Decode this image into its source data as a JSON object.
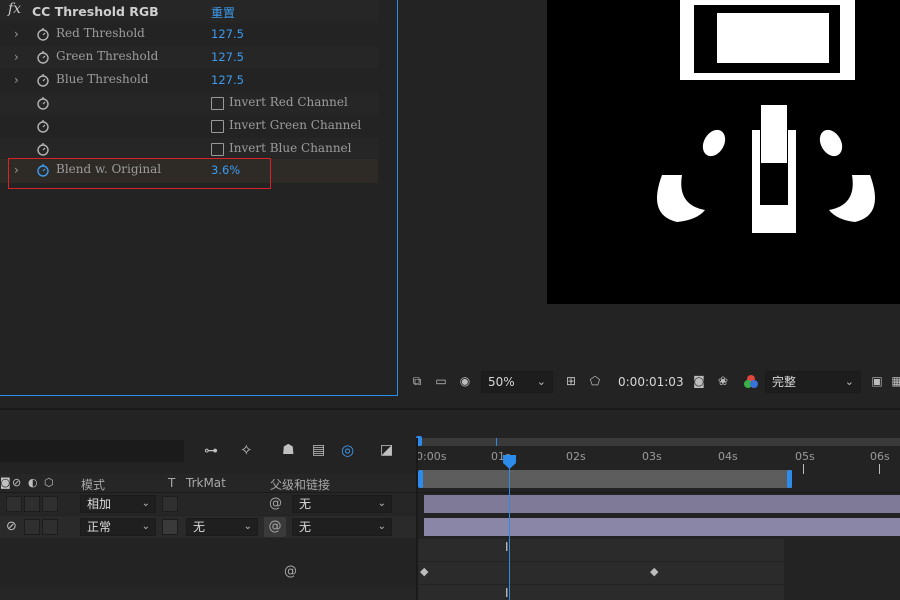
{
  "effect": {
    "fx_label": "fx",
    "name": "CC Threshold RGB",
    "reset": "重置",
    "params": [
      {
        "label": "Red Threshold",
        "value": "127.5"
      },
      {
        "label": "Green Threshold",
        "value": "127.5"
      },
      {
        "label": "Blue Threshold",
        "value": "127.5"
      }
    ],
    "checkboxes": [
      {
        "label": "Invert Red Channel",
        "checked": false
      },
      {
        "label": "Invert Green Channel",
        "checked": false
      },
      {
        "label": "Invert Blue Channel",
        "checked": false
      }
    ],
    "blend": {
      "label": "Blend w. Original",
      "value": "3.6%"
    },
    "highlight_color": "#d8232a",
    "accent_color": "#2d8ceb"
  },
  "viewer": {
    "zoom": "50%",
    "timecode": "0:00:01:03",
    "resolution": "完整"
  },
  "timeline": {
    "columns": {
      "mode": "模式",
      "t": "T",
      "trkmat": "TrkMat",
      "parent": "父级和链接"
    },
    "layers": [
      {
        "mode": "相加",
        "trkmat": "",
        "parent": "无"
      },
      {
        "mode": "正常",
        "trkmat": "无",
        "parent": "无"
      }
    ],
    "ruler": [
      "0:00s",
      "01s",
      "02s",
      "03s",
      "04s",
      "05s",
      "06s"
    ],
    "layer_bar_color": "#8a86a8",
    "work_area_color": "#5d5d5d"
  }
}
